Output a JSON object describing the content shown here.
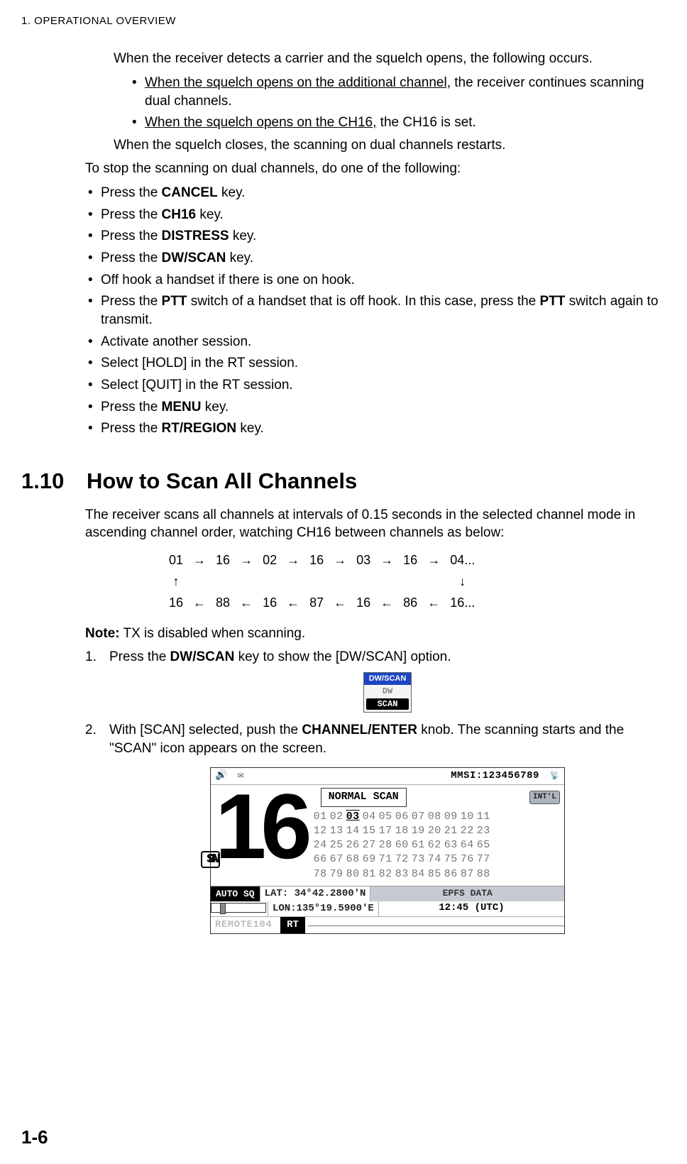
{
  "header": {
    "chapter": "1.  OPERATIONAL OVERVIEW"
  },
  "intro": {
    "p1": "When the receiver detects a carrier and the squelch opens, the following occurs.",
    "b1u": "When the squelch opens on the additional channel,",
    "b1r": " the receiver continues scanning dual channels.",
    "b2u": "When the squelch opens on the CH16,",
    "b2r": " the CH16 is set.",
    "p2": "When the squelch closes, the scanning on dual channels restarts.",
    "p3": "To stop the scanning on dual channels, do one of the following:"
  },
  "stoplist": {
    "i1a": "Press the ",
    "i1b": "CANCEL",
    "i1c": " key.",
    "i2a": "Press the ",
    "i2b": "CH16",
    "i2c": " key.",
    "i3a": "Press the ",
    "i3b": "DISTRESS",
    "i3c": " key.",
    "i4a": "Press the ",
    "i4b": "DW/SCAN",
    "i4c": " key.",
    "i5": "Off hook a handset if there is one on hook.",
    "i6a": "Press the ",
    "i6b": "PTT",
    "i6c": " switch of a handset that is off hook. In this case, press the ",
    "i6d": "PTT",
    "i6e": " switch again to transmit.",
    "i7": "Activate another session.",
    "i8": "Select [HOLD] in the RT session.",
    "i9": "Select [QUIT] in the RT session.",
    "i10a": "Press the ",
    "i10b": "MENU",
    "i10c": " key.",
    "i11a": "Press the ",
    "i11b": "RT/REGION",
    "i11c": " key."
  },
  "section": {
    "num": "1.10",
    "title": "How to Scan All Channels",
    "desc": "The receiver scans all channels at intervals of 0.15 seconds in the selected channel mode in ascending channel order, watching CH16 between channels as below:"
  },
  "scanseq": {
    "r1": [
      "01",
      "→",
      "16",
      "→",
      "02",
      "→",
      "16",
      "→",
      "03",
      "→",
      "16",
      "→",
      "04..."
    ],
    "r2": [
      "↑",
      "",
      "",
      "",
      "",
      "",
      "",
      "",
      "",
      "",
      "",
      "",
      "↓"
    ],
    "r3": [
      "16",
      "←",
      "88",
      "←",
      "16",
      "←",
      "87",
      "←",
      "16",
      "←",
      "86",
      "←",
      "16..."
    ]
  },
  "note": {
    "label": "Note:",
    "text": " TX is disabled when scanning."
  },
  "steps": {
    "s1n": "1.",
    "s1a": "Press the ",
    "s1b": "DW/SCAN",
    "s1c": " key to show the [DW/SCAN] option.",
    "s2n": "2.",
    "s2a": "With [SCAN] selected, push the ",
    "s2b": "CHANNEL/ENTER",
    "s2c": " knob. The scanning starts and the \"SCAN\" icon appears on the screen."
  },
  "dwscan_widget": {
    "head": "DW/SCAN",
    "dw": "DW",
    "scan": "SCAN"
  },
  "screen": {
    "mmsi_label": "MMSI:",
    "mmsi": "123456789",
    "big": "16",
    "scan_badge": "SCAN",
    "normal_scan": "NORMAL SCAN",
    "intl": "INT'L",
    "channels": {
      "l1": [
        "01",
        "02",
        "03",
        "04",
        "05",
        "06",
        "07",
        "08",
        "09",
        "10",
        "11"
      ],
      "l2": [
        "12",
        "13",
        "14",
        "15",
        "17",
        "18",
        "19",
        "20",
        "21",
        "22",
        "23"
      ],
      "l3": [
        "24",
        "25",
        "26",
        "27",
        "28",
        "60",
        "61",
        "62",
        "63",
        "64",
        "65"
      ],
      "l4": [
        "66",
        "67",
        "68",
        "69",
        "71",
        "72",
        "73",
        "74",
        "75",
        "76",
        "77"
      ],
      "l5": [
        "78",
        "79",
        "80",
        "81",
        "82",
        "83",
        "84",
        "85",
        "86",
        "87",
        "88"
      ],
      "current": "03"
    },
    "auto_sq": "AUTO SQ",
    "lat": "LAT: 34°42.2800'N",
    "lon": "LON:135°19.5900'E",
    "epfs": "EPFS DATA",
    "time": "12:45 (UTC)",
    "remote": "REMOTE104",
    "rt": "RT"
  },
  "page": "1-6"
}
